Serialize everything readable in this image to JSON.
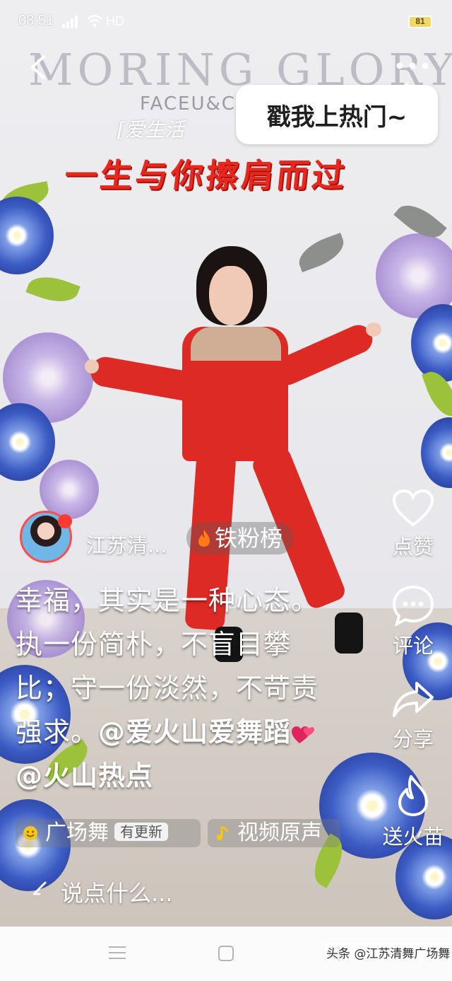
{
  "status_bar": {
    "time": "08:51",
    "network": "4G",
    "hd_label": "HD",
    "battery": "81"
  },
  "video": {
    "wall_brand": "MORING GLORY",
    "wall_subbrand": "FACEU&C",
    "wall_tag": "[爱生活",
    "title_overlay": "一生与你擦肩而过"
  },
  "top_bar": {
    "back_icon": "chevron-left-icon",
    "more_icon": "more-dots-icon",
    "hot_bubble": "戳我上热门~"
  },
  "actions": [
    {
      "icon": "heart-outline-icon",
      "label": "点赞"
    },
    {
      "icon": "comment-bubble-icon",
      "label": "评论"
    },
    {
      "icon": "share-arrow-icon",
      "label": "分享"
    },
    {
      "icon": "flame-outline-icon",
      "label": "送火苗"
    }
  ],
  "author": {
    "name": "江苏清...",
    "fans_chip": "铁粉榜"
  },
  "caption": {
    "line1": "幸福，其实是一种心态。",
    "line2": "执一份简朴，不盲目攀",
    "line3": "比；守一份淡然，不苛责",
    "line4_text": "强求。",
    "mention1": "@爱火山爱舞蹈",
    "mention2": "@火山热点"
  },
  "tags": {
    "dance": "广场舞",
    "update_badge": "有更新",
    "sound": "视频原声"
  },
  "comment": {
    "placeholder": "说点什么..."
  },
  "watermark": "头条 @江苏清舞广场舞",
  "colors": {
    "title_red": "#e8281e",
    "suit_red": "#dd2a24",
    "flower_blue": "#3c5bc4",
    "battery_yellow": "#f3d868"
  }
}
